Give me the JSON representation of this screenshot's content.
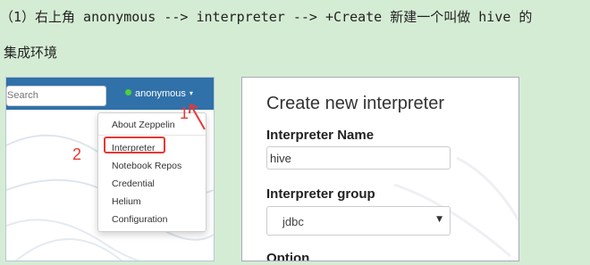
{
  "caption": {
    "line1": "（1）右上角 anonymous --> interpreter --> +Create 新建一个叫做 hive 的",
    "line2": "集成环境"
  },
  "left_screenshot": {
    "search_placeholder": "Search",
    "user_name": "anonymous",
    "caret": "▾",
    "dropdown_items": [
      "About Zeppelin",
      "Interpreter",
      "Notebook Repos",
      "Credential",
      "Helium",
      "Configuration"
    ],
    "annotation_1": "1",
    "annotation_2": "2",
    "colors": {
      "navbar": "#3071a9",
      "status_online": "#4cd137",
      "annotation_red": "#e53935"
    }
  },
  "right_screenshot": {
    "title": "Create new interpreter",
    "name_label": "Interpreter Name",
    "name_value": "hive",
    "group_label": "Interpreter group",
    "group_value": "jdbc",
    "option_label": "Option"
  }
}
